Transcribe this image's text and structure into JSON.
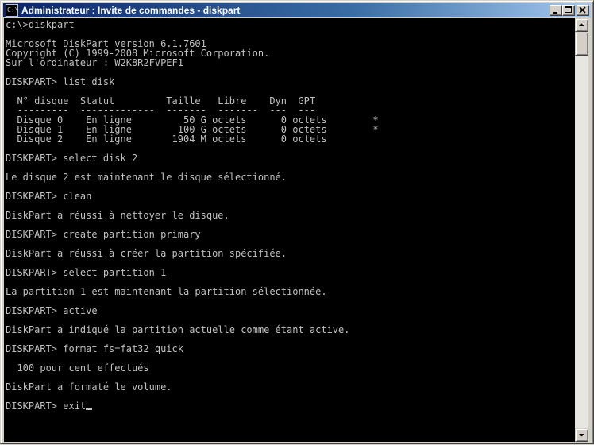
{
  "window": {
    "title": "Administrateur : Invite de commandes - diskpart",
    "icon": "C:\\",
    "controls": {
      "minimize": "minimize-icon",
      "maximize": "maximize-icon",
      "close": "close-icon"
    }
  },
  "console": {
    "lines": [
      "c:\\>diskpart",
      "",
      "Microsoft DiskPart version 6.1.7601",
      "Copyright (C) 1999-2008 Microsoft Corporation.",
      "Sur l'ordinateur : W2K8R2FVPEF1",
      "",
      "DISKPART> list disk",
      "",
      "  N° disque  Statut         Taille   Libre    Dyn  GPT",
      "  ---------  -------------  -------  -------  ---  ---",
      "  Disque 0    En ligne         50 G octets      0 octets        *",
      "  Disque 1    En ligne        100 G octets      0 octets        *",
      "  Disque 2    En ligne       1904 M octets      0 octets",
      "",
      "DISKPART> select disk 2",
      "",
      "Le disque 2 est maintenant le disque sélectionné.",
      "",
      "DISKPART> clean",
      "",
      "DiskPart a réussi à nettoyer le disque.",
      "",
      "DISKPART> create partition primary",
      "",
      "DiskPart a réussi à créer la partition spécifiée.",
      "",
      "DISKPART> select partition 1",
      "",
      "La partition 1 est maintenant la partition sélectionnée.",
      "",
      "DISKPART> active",
      "",
      "DiskPart a indiqué la partition actuelle comme étant active.",
      "",
      "DISKPART> format fs=fat32 quick",
      "",
      "  100 pour cent effectués",
      "",
      "DiskPart a formaté le volume.",
      ""
    ],
    "prompt_line": "DISKPART> exit"
  },
  "scrollbar": {
    "up_icon": "scroll-up-arrow-icon",
    "down_icon": "scroll-down-arrow-icon"
  }
}
